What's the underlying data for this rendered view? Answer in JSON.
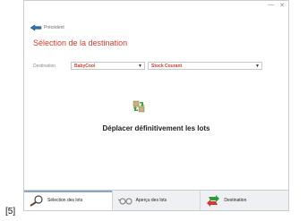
{
  "window": {
    "controls": {
      "minimize": "—",
      "close": "✕"
    }
  },
  "back_button": {
    "label": "Précédent"
  },
  "page_title": "Sélection de la destination",
  "destination": {
    "label": "Destination",
    "select1_value": "BabyCool",
    "select2_value": "Stock Courant"
  },
  "action": {
    "label": "Déplacer définitivement les lots"
  },
  "steps": [
    {
      "label": "Sélection des lots",
      "icon": "magnifier-icon"
    },
    {
      "label": "Aperçu des lots",
      "icon": "glasses-icon"
    },
    {
      "label": "Destination",
      "icon": "move-arrows-icon"
    }
  ],
  "footnote": "[5]",
  "colors": {
    "accent": "#d63b2f",
    "bar": "#eef0f3"
  }
}
